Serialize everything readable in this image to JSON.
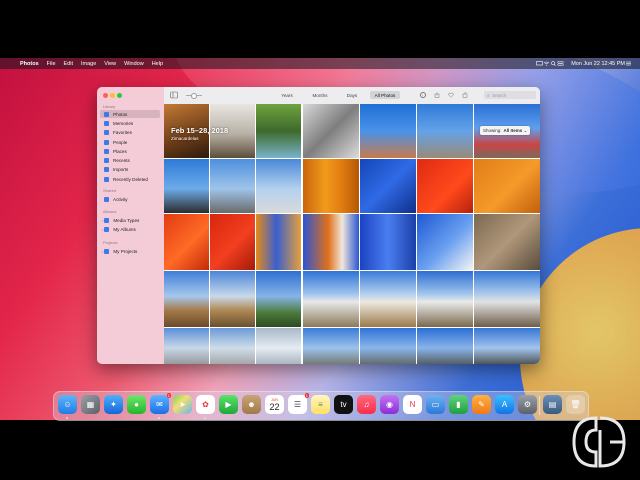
{
  "menubar": {
    "items": [
      "Photos",
      "File",
      "Edit",
      "Image",
      "View",
      "Window",
      "Help"
    ],
    "clock": "Mon Jun 22  12:45 PM"
  },
  "sidebar": {
    "sections": {
      "library": "Library",
      "shared": "Shared",
      "albums": "Albums",
      "projects": "Projects"
    },
    "library_items": [
      "Photos",
      "Memories",
      "Favorites",
      "People",
      "Places",
      "Recents",
      "Imports",
      "Recently Deleted"
    ],
    "shared_items": [
      "Activity"
    ],
    "album_items": [
      "Media Types",
      "My Albums"
    ],
    "project_items": [
      "My Projects"
    ]
  },
  "toolbar": {
    "tabs": [
      "Years",
      "Months",
      "Days",
      "All Photos"
    ],
    "selected_tab": "All Photos",
    "search_placeholder": "Search"
  },
  "grid": {
    "date_header": "Feb 15–28, 2018",
    "location": "Zimacardelas",
    "showing_label": "Showing:",
    "showing_value": "All Items ⌄"
  },
  "dock": {
    "calendar_month": "JUN",
    "calendar_day": "22",
    "messages_badge": "1",
    "reminders_badge": "1"
  },
  "colors": {
    "accent": "#3b7ae8",
    "sidebar_bg": "#f3ccd8",
    "toolbar_bg": "#ededef"
  },
  "icons": {
    "menubar_left": "apple-logo-icon",
    "toolbar": [
      "info-icon",
      "share-icon",
      "favorite-icon",
      "rotate-icon",
      "search-icon"
    ]
  }
}
